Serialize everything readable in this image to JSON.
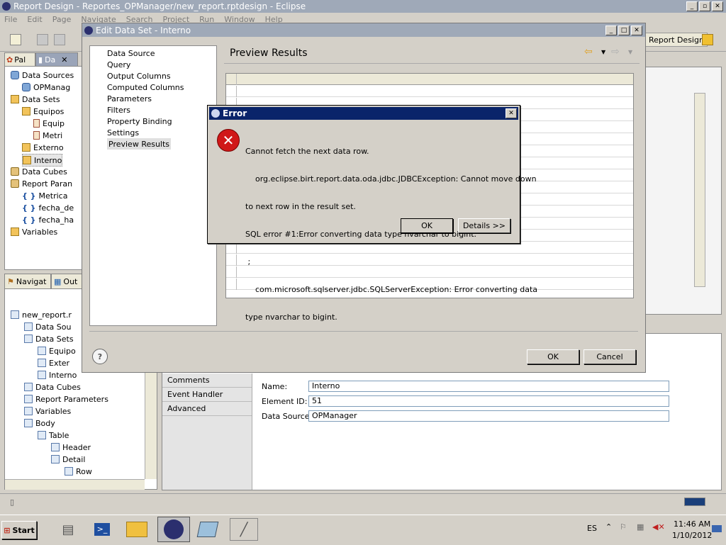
{
  "eclipse": {
    "title": "Report Design - Reportes_OPManager/new_report.rptdesign - Eclipse",
    "menu": [
      "File",
      "Edit",
      "Page",
      "Navigate",
      "Search",
      "Project",
      "Run",
      "Window",
      "Help"
    ],
    "perspective": "Report Design",
    "palette_tab": "Pal",
    "data_tab": "Da",
    "navigator_tab": "Navigat",
    "outline_tab": "Out"
  },
  "data_explorer": {
    "items": [
      {
        "label": "Data Sources",
        "level": 0,
        "icon": "database"
      },
      {
        "label": "OPManag",
        "level": 1,
        "icon": "datasource"
      },
      {
        "label": "Data Sets",
        "level": 0,
        "icon": "dataset"
      },
      {
        "label": "Equipos",
        "level": 1,
        "icon": "dataset"
      },
      {
        "label": "Equip",
        "level": 2,
        "icon": "column"
      },
      {
        "label": "Metri",
        "level": 2,
        "icon": "column"
      },
      {
        "label": "Externo",
        "level": 1,
        "icon": "dataset"
      },
      {
        "label": "Interno",
        "level": 1,
        "icon": "dataset"
      },
      {
        "label": "Data Cubes",
        "level": 0,
        "icon": "cube"
      },
      {
        "label": "Report Paran",
        "level": 0,
        "icon": "param-group"
      },
      {
        "label": "Metrica",
        "level": 1,
        "icon": "param"
      },
      {
        "label": "fecha_de",
        "level": 1,
        "icon": "param"
      },
      {
        "label": "fecha_ha",
        "level": 1,
        "icon": "param"
      },
      {
        "label": "Variables",
        "level": 0,
        "icon": "variables"
      }
    ]
  },
  "outline": {
    "items": [
      {
        "label": "new_report.r",
        "level": 0
      },
      {
        "label": "Data Sou",
        "level": 1
      },
      {
        "label": "Data Sets",
        "level": 1
      },
      {
        "label": "Equipo",
        "level": 2
      },
      {
        "label": "Exter",
        "level": 2
      },
      {
        "label": "Interno",
        "level": 2
      },
      {
        "label": "Data Cubes",
        "level": 1
      },
      {
        "label": "Report Parameters",
        "level": 1
      },
      {
        "label": "Variables",
        "level": 1
      },
      {
        "label": "Body",
        "level": 1
      },
      {
        "label": "Table",
        "level": 2
      },
      {
        "label": "Header",
        "level": 3
      },
      {
        "label": "Detail",
        "level": 3
      },
      {
        "label": "Row",
        "level": 4
      }
    ]
  },
  "properties": {
    "categories": [
      "Comments",
      "Event Handler",
      "Advanced"
    ],
    "name_label": "Name:",
    "name_value": "Interno",
    "element_id_label": "Element ID:",
    "element_id_value": "51",
    "data_source_label": "Data Source",
    "data_source_value": "OPManager"
  },
  "edit_dialog": {
    "title": "Edit Data Set - Interno",
    "nav": [
      "Data Source",
      "Query",
      "Output Columns",
      "Computed Columns",
      "Parameters",
      "Filters",
      "Property Binding",
      "Settings",
      "Preview Results"
    ],
    "selected": "Preview Results",
    "page_title": "Preview Results",
    "ok": "OK",
    "cancel": "Cancel",
    "help": "?"
  },
  "error_dialog": {
    "title": "Error",
    "lines": [
      "Cannot fetch the next data row.",
      "    org.eclipse.birt.report.data.oda.jdbc.JDBCException: Cannot move down",
      "to next row in the result set.",
      "SQL error #1:Error converting data type nvarchar to bigint.",
      " ;",
      "    com.microsoft.sqlserver.jdbc.SQLServerException: Error converting data",
      "type nvarchar to bigint."
    ],
    "ok": "OK",
    "details": "Details >>"
  },
  "taskbar": {
    "start": "Start",
    "lang": "ES",
    "time": "11:46 AM",
    "date": "1/10/2012"
  },
  "colors": {
    "title_active": "#0a246a",
    "error_red": "#d01818",
    "taskbar": "#d4d0c8"
  }
}
